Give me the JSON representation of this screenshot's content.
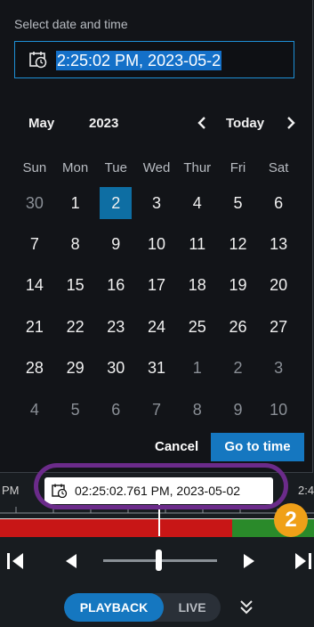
{
  "picker": {
    "title": "Select date and time",
    "input_value": "2:25:02 PM, 2023-05-2",
    "month": "May",
    "year": "2023",
    "today_label": "Today",
    "weekdays": [
      "Sun",
      "Mon",
      "Tue",
      "Wed",
      "Thur",
      "Fri",
      "Sat"
    ],
    "weeks": [
      [
        "30",
        "1",
        "2",
        "3",
        "4",
        "5",
        "6"
      ],
      [
        "7",
        "8",
        "9",
        "10",
        "11",
        "12",
        "13"
      ],
      [
        "14",
        "15",
        "16",
        "17",
        "18",
        "19",
        "20"
      ],
      [
        "21",
        "22",
        "23",
        "24",
        "25",
        "26",
        "27"
      ],
      [
        "28",
        "29",
        "30",
        "31",
        "1",
        "2",
        "3"
      ],
      [
        "4",
        "5",
        "6",
        "7",
        "8",
        "9",
        "10"
      ]
    ],
    "selected_day": "2",
    "cancel_label": "Cancel",
    "goto_label": "Go to time"
  },
  "timeline": {
    "left_label": "PM",
    "right_label": "2:4",
    "timestamp": "02:25:02.761 PM, 2023-05-02",
    "badge": "2"
  },
  "mode": {
    "playback_label": "PLAYBACK",
    "live_label": "LIVE",
    "active": "PLAYBACK"
  },
  "colors": {
    "accent": "#1577c0",
    "recording": "#c81616",
    "motion": "#2a8a2a",
    "highlight": "#6b2b8a",
    "badge": "#f0a018"
  },
  "icons": [
    "clock-icon",
    "chevron-left-icon",
    "chevron-right-icon",
    "skip-start-icon",
    "step-back-icon",
    "step-forward-icon",
    "skip-end-icon",
    "double-chevron-down-icon"
  ]
}
